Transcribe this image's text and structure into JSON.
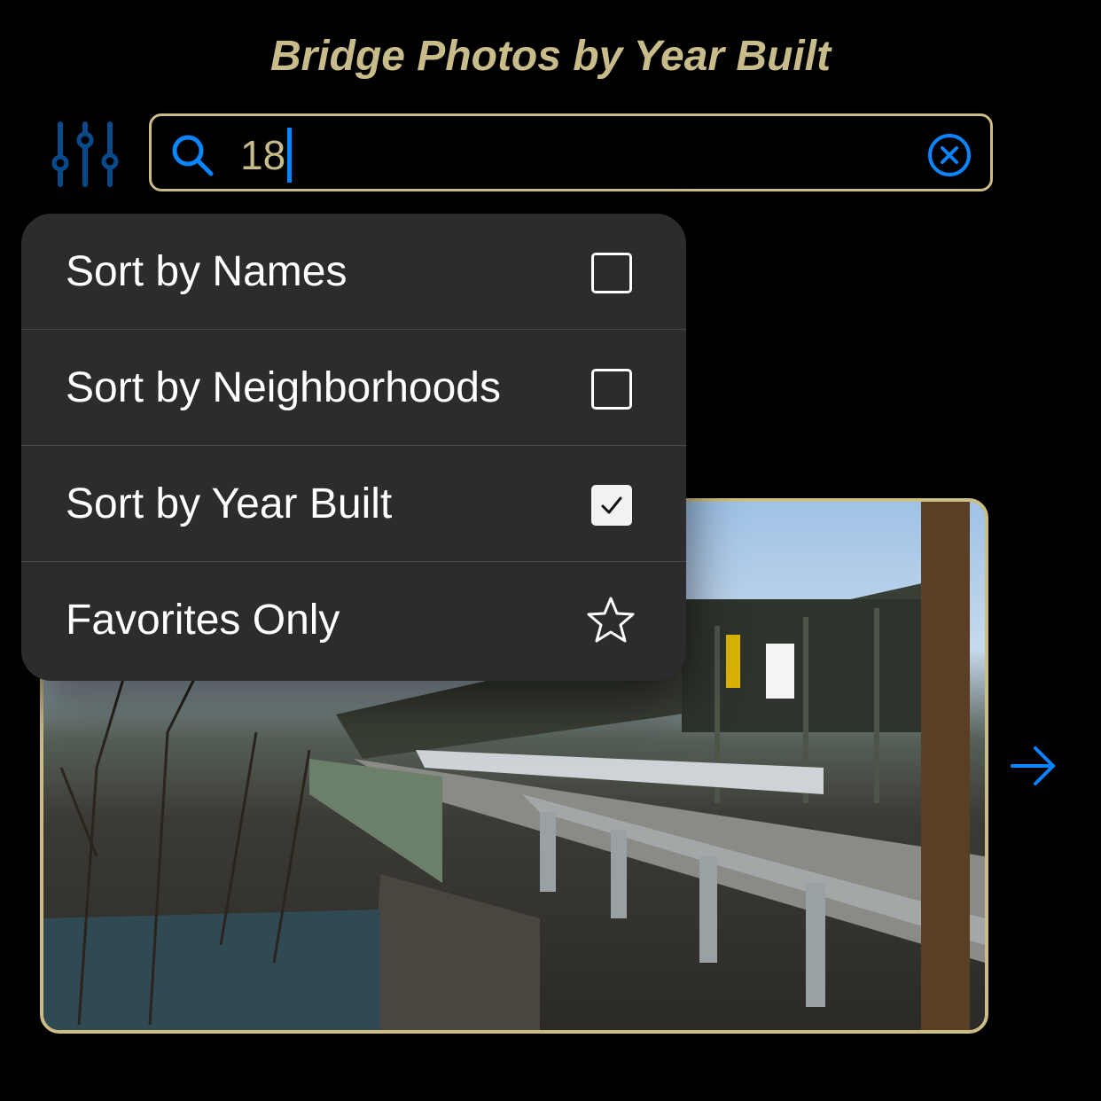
{
  "header": {
    "title": "Bridge Photos by Year Built"
  },
  "search": {
    "value": "18"
  },
  "menu": {
    "items": [
      {
        "label": "Sort by Names",
        "checked": false
      },
      {
        "label": "Sort by Neighborhoods",
        "checked": false
      },
      {
        "label": "Sort by Year Built",
        "checked": true
      },
      {
        "label": "Favorites Only",
        "icon": "star-icon"
      }
    ]
  },
  "colors": {
    "accent_blue": "#0a84ff",
    "gold": "#c8bc8a",
    "menu_bg": "#2c2c2e",
    "background": "#000000"
  },
  "icons": {
    "filter": "sliders-icon",
    "search": "search-icon",
    "clear": "clear-circle-icon",
    "next": "arrow-right-icon"
  }
}
